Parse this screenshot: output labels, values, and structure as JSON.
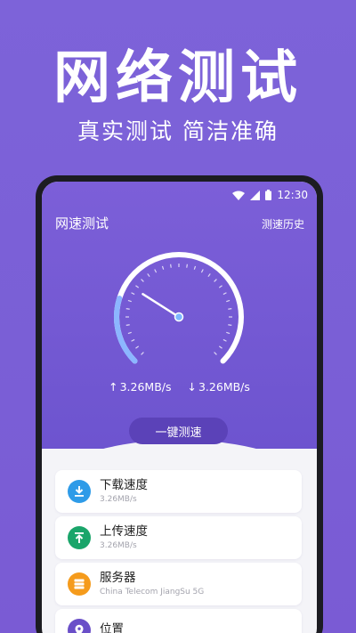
{
  "promo": {
    "title": "网络测试",
    "subtitle": "真实测试 简洁准确"
  },
  "status_bar": {
    "time": "12:30",
    "icons": [
      "wifi-icon",
      "cellular-signal-icon",
      "battery-icon"
    ]
  },
  "app": {
    "title": "网速测试",
    "history_label": "测速历史",
    "upload_arrow": "↑",
    "upload_value": "3.26MB/s",
    "download_arrow": "↓",
    "download_value": "3.26MB/s",
    "test_button_label": "一键测速"
  },
  "gauge": {
    "level": 0.12,
    "colors": {
      "arc": "#ffffff",
      "accent": "#8cb6ff",
      "needle": "#ffffff",
      "hub": "#7fb7ff"
    }
  },
  "cards": [
    {
      "title": "下载速度",
      "sub": "3.26MB/s",
      "icon": "download-icon",
      "color": "#2e9be8"
    },
    {
      "title": "上传速度",
      "sub": "3.26MB/s",
      "icon": "upload-icon",
      "color": "#1aa56a"
    },
    {
      "title": "服务器",
      "sub": "China Telecom JiangSu 5G",
      "icon": "server-icon",
      "color": "#f59b1c"
    },
    {
      "title": "位置",
      "sub": "",
      "icon": "location-pin-icon",
      "color": "#6a4fc8"
    }
  ]
}
